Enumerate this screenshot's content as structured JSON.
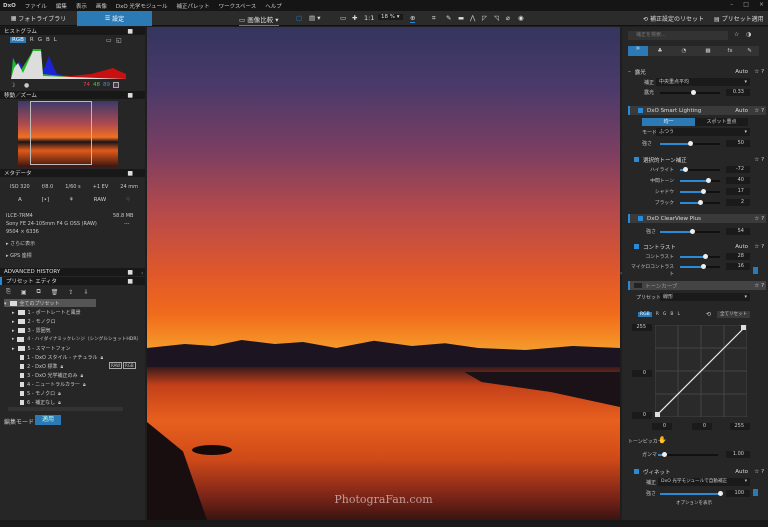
{
  "menubar": {
    "logo": "DxO",
    "items": [
      "ファイル",
      "編集",
      "表示",
      "画像",
      "DxO 光学モジュール",
      "補正パレット",
      "ワークスペース",
      "ヘルプ"
    ]
  },
  "toolbar": {
    "tab_library": "フォトライブラリ",
    "tab_edit": "設定",
    "compare": "画像比較",
    "zoom_1to1": "1:1",
    "zoom_value": "18 %",
    "reset": "補正設定のリセット",
    "apply_preset": "プリセット適用"
  },
  "left": {
    "histogram": {
      "title": "ヒストグラム",
      "channels": [
        "RGB",
        "R",
        "G",
        "B",
        "L"
      ],
      "values": [
        "74",
        "48",
        "89"
      ]
    },
    "navigator": {
      "title": "移動／ズーム"
    },
    "metadata": {
      "title": "メタデータ",
      "iso": "ISO 320",
      "aperture": "f/8.0",
      "shutter": "1/60 s",
      "ev": "+1 EV",
      "focal": "24 mm",
      "mode": "A",
      "format": "RAW",
      "camera": "ILCE-7RM4",
      "size": "58.8 MB",
      "lens": "Sony FE 24-105mm F4 G OSS (RAW)",
      "dims": "9504 × 6336",
      "dash": "---",
      "more": "さらに表示",
      "gps": "GPS 座標"
    },
    "history_title": "ADVANCED HISTORY",
    "preset_editor": {
      "title": "プリセット エディタ",
      "root": "全てのプリセット",
      "folders": [
        "1 - ポートレートと風景",
        "2 - モノクロ",
        "3 - 雰囲気",
        "4 - ハイダイナミックレンジ（シングルショットHDR）",
        "5 - スマートフォン"
      ],
      "presets": [
        "1 - DxO スタイル - ナチュラル",
        "2 - DxO 標準",
        "3 - DxO 光学補正のみ",
        "4 - ニュートラルカラー",
        "5 - モノクロ",
        "6 - 補正なし"
      ],
      "badges": [
        "RAW",
        "RGB"
      ],
      "edit_mode": "編集モード",
      "apply": "適用"
    }
  },
  "image": {
    "watermark": "PhotograFan.com"
  },
  "right": {
    "search_placeholder": "補正を検索...",
    "exposure": {
      "title": "露光",
      "auto": "Auto",
      "corr_label": "補正",
      "corr_value": "中央重点平均",
      "exp_label": "露光",
      "exp_value": "0.33",
      "exp_fraction": 0.55
    },
    "smart_lighting": {
      "title": "DxO Smart Lighting",
      "auto": "Auto",
      "mode_uniform": "均一",
      "mode_spot": "スポット重点",
      "mode_label": "モード",
      "mode_value": "ふつう",
      "strength_label": "強さ",
      "strength_value": "50",
      "strength_fraction": 0.5
    },
    "selective_tone": {
      "title": "選択的トーン補正",
      "rows": [
        {
          "label": "ハイライト",
          "value": "-72",
          "pos": 0.14
        },
        {
          "label": "中間トーン",
          "value": "40",
          "pos": 0.7
        },
        {
          "label": "シャドウ",
          "value": "17",
          "pos": 0.58
        },
        {
          "label": "ブラック",
          "value": "2",
          "pos": 0.51
        }
      ]
    },
    "clearview": {
      "title": "DxO ClearView Plus",
      "strength_label": "強さ",
      "strength_value": "54",
      "strength_fraction": 0.54
    },
    "contrast": {
      "title": "コントラスト",
      "auto": "Auto",
      "rows": [
        {
          "label": "コントラスト",
          "value": "28",
          "pos": 0.64
        },
        {
          "label": "マイクロコントラスト",
          "value": "16",
          "pos": 0.58
        }
      ]
    },
    "tone_curve": {
      "title": "トーンカーブ",
      "preset_label": "プリセット",
      "preset_value": "線形",
      "channels": [
        "RGB",
        "R",
        "G",
        "B",
        "L"
      ],
      "reset_all": "全てリセット",
      "top_value": "255",
      "mid_value": "0",
      "bottom_value": "0",
      "x_values": [
        "0",
        "0",
        "255"
      ],
      "picker_label": "トーンピッカー",
      "gamma_label": "ガンマ",
      "gamma_value": "1.00",
      "gamma_fraction": 0.1
    },
    "vignette": {
      "title": "ヴィネット",
      "auto": "Auto",
      "corr_label": "補正",
      "corr_value": "DxO 光学モジュールで自動補正",
      "strength_label": "強さ",
      "strength_value": "100",
      "strength_fraction": 1.0,
      "show_options": "オプションを表示"
    }
  },
  "colors": {
    "accent": "#2b79b5",
    "panel": "#262626",
    "header": "#181818"
  }
}
